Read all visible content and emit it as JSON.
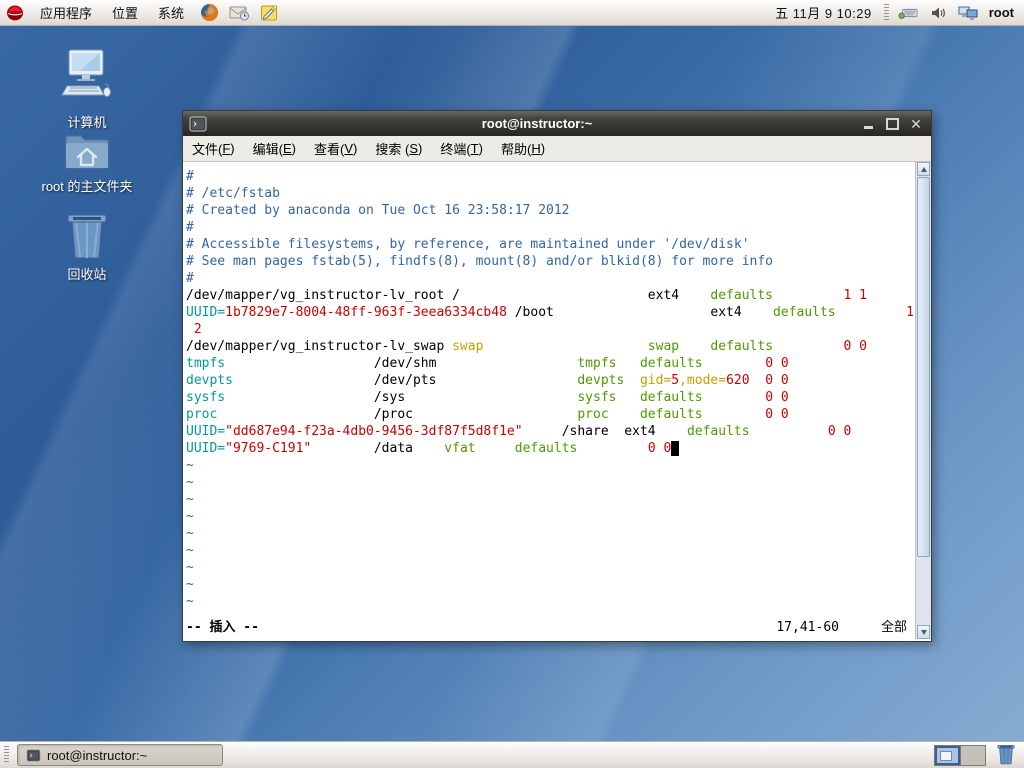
{
  "colors": {
    "comment": "#3465a4",
    "teal": "#06989a",
    "green": "#4e9a06",
    "yellow": "#c4a000",
    "red": "#cc0000",
    "text": "#000000",
    "term_bg": "#ffffff",
    "accent_blue": "#39618f"
  },
  "panel_top": {
    "menus": [
      {
        "label": "应用程序"
      },
      {
        "label": "位置"
      },
      {
        "label": "系统"
      }
    ],
    "clock": "五 11月  9 10:29",
    "user": "root"
  },
  "desktop": {
    "icons": [
      {
        "label": "计算机",
        "type": "computer"
      },
      {
        "label": "root 的主文件夹",
        "type": "home-folder"
      },
      {
        "label": "回收站",
        "type": "trash"
      }
    ]
  },
  "window": {
    "title": "root@instructor:~",
    "menu": [
      {
        "label": "文件",
        "accel": "F"
      },
      {
        "label": "编辑",
        "accel": "E"
      },
      {
        "label": "查看",
        "accel": "V"
      },
      {
        "label": "搜索 ",
        "accel": "S"
      },
      {
        "label": "终端",
        "accel": "T"
      },
      {
        "label": "帮助",
        "accel": "H"
      }
    ]
  },
  "vim": {
    "rows": [
      [
        [
          "c",
          "#"
        ]
      ],
      [
        [
          "c",
          "# /etc/fstab"
        ]
      ],
      [
        [
          "c",
          "# Created by anaconda on Tue Oct 16 23:58:17 2012"
        ]
      ],
      [
        [
          "c",
          "#"
        ]
      ],
      [
        [
          "c",
          "# Accessible filesystems, by reference, are maintained under '/dev/disk'"
        ]
      ],
      [
        [
          "c",
          "# See man pages fstab(5), findfs(8), mount(8) and/or blkid(8) for more info"
        ]
      ],
      [
        [
          "c",
          "#"
        ]
      ],
      [
        [
          "k",
          "/dev/mapper/vg_instructor-lv_root /"
        ],
        [
          "k",
          "                        ext4    "
        ],
        [
          "g",
          "defaults"
        ],
        [
          "k",
          "         "
        ],
        [
          "r",
          "1 1"
        ]
      ],
      [
        [
          "t",
          "UUID="
        ],
        [
          "r",
          "1b7829e7-8004-48ff-963f-3eea6334cb48"
        ],
        [
          "k",
          " /boot                    ext4    "
        ],
        [
          "g",
          "defaults"
        ],
        [
          "k",
          "         "
        ],
        [
          "r",
          "1"
        ]
      ],
      [
        [
          "r",
          " 2"
        ]
      ],
      [
        [
          "k",
          "/dev/mapper/vg_instructor-lv_swap "
        ],
        [
          "y",
          "swap"
        ],
        [
          "k",
          "                     "
        ],
        [
          "g",
          "swap"
        ],
        [
          "k",
          "    "
        ],
        [
          "g",
          "defaults"
        ],
        [
          "k",
          "         "
        ],
        [
          "r",
          "0 0"
        ]
      ],
      [
        [
          "t",
          "tmpfs"
        ],
        [
          "k",
          "                   /dev/shm                  "
        ],
        [
          "g",
          "tmpfs"
        ],
        [
          "k",
          "   "
        ],
        [
          "g",
          "defaults"
        ],
        [
          "k",
          "        "
        ],
        [
          "r",
          "0 0"
        ]
      ],
      [
        [
          "t",
          "devpts"
        ],
        [
          "k",
          "                  /dev/pts                  "
        ],
        [
          "g",
          "devpts"
        ],
        [
          "k",
          "  "
        ],
        [
          "y",
          "gid="
        ],
        [
          "r",
          "5"
        ],
        [
          "y",
          ",mode="
        ],
        [
          "r",
          "620"
        ],
        [
          "k",
          "  "
        ],
        [
          "r",
          "0 0"
        ]
      ],
      [
        [
          "t",
          "sysfs"
        ],
        [
          "k",
          "                   /sys                      "
        ],
        [
          "g",
          "sysfs"
        ],
        [
          "k",
          "   "
        ],
        [
          "g",
          "defaults"
        ],
        [
          "k",
          "        "
        ],
        [
          "r",
          "0 0"
        ]
      ],
      [
        [
          "t",
          "proc"
        ],
        [
          "k",
          "                    /proc                     "
        ],
        [
          "g",
          "proc"
        ],
        [
          "k",
          "    "
        ],
        [
          "g",
          "defaults"
        ],
        [
          "k",
          "        "
        ],
        [
          "r",
          "0 0"
        ]
      ],
      [
        [
          "t",
          "UUID="
        ],
        [
          "r",
          "\"dd687e94-f23a-4db0-9456-3df87f5d8f1e\""
        ],
        [
          "k",
          "     /share  ext4    "
        ],
        [
          "g",
          "defaults"
        ],
        [
          "k",
          "          "
        ],
        [
          "r",
          "0 0"
        ]
      ],
      [
        [
          "t",
          "UUID="
        ],
        [
          "r",
          "\"9769-C191\""
        ],
        [
          "k",
          "        /data    "
        ],
        [
          "g",
          "vfat"
        ],
        [
          "k",
          "     "
        ],
        [
          "g",
          "defaults"
        ],
        [
          "k",
          "         "
        ],
        [
          "r",
          "0 0"
        ],
        [
          "cur",
          " "
        ]
      ]
    ],
    "tilde_count": 9,
    "tilde_char": "~",
    "status_left": "-- 插入 --",
    "ruler": "17,41-60",
    "scroll_pos": "全部"
  },
  "taskbar": {
    "task_label": "root@instructor:~"
  }
}
